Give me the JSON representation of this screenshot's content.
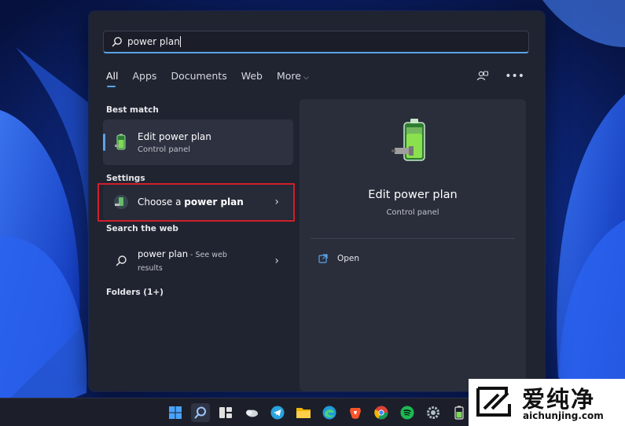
{
  "search": {
    "query": "power plan",
    "icon": "search-icon"
  },
  "tabs": [
    {
      "label": "All",
      "active": true
    },
    {
      "label": "Apps"
    },
    {
      "label": "Documents"
    },
    {
      "label": "Web"
    },
    {
      "label": "More",
      "dropdown": true
    }
  ],
  "header_icons": [
    "connected-accounts-icon",
    "more-options-icon"
  ],
  "sections": {
    "best_match": "Best match",
    "settings": "Settings",
    "search_web": "Search the web",
    "folders": "Folders (1+)"
  },
  "best_match": {
    "title": "Edit power plan",
    "subtitle": "Control panel",
    "icon": "battery-icon"
  },
  "settings_result": {
    "title_prefix": "Choose a ",
    "title_bold": "power plan",
    "icon": "power-plan-icon"
  },
  "web_result": {
    "query": "power plan",
    "suffix": " - See web",
    "suffix2": "results"
  },
  "preview": {
    "title": "Edit power plan",
    "subtitle": "Control panel",
    "action_open": "Open"
  },
  "taskbar": [
    "windows-start-icon",
    "search-icon",
    "widgets-icon",
    "weather-icon",
    "telegram-icon",
    "file-explorer-icon",
    "edge-icon",
    "brave-icon",
    "chrome-icon",
    "spotify-icon",
    "settings-icon",
    "battery-icon"
  ],
  "watermark": {
    "brand_cn": "爱纯净",
    "url": "aichunjing.com"
  },
  "colors": {
    "accent": "#5aa3e8",
    "highlight_red": "#d0202a",
    "flyout_bg": "#202431"
  }
}
